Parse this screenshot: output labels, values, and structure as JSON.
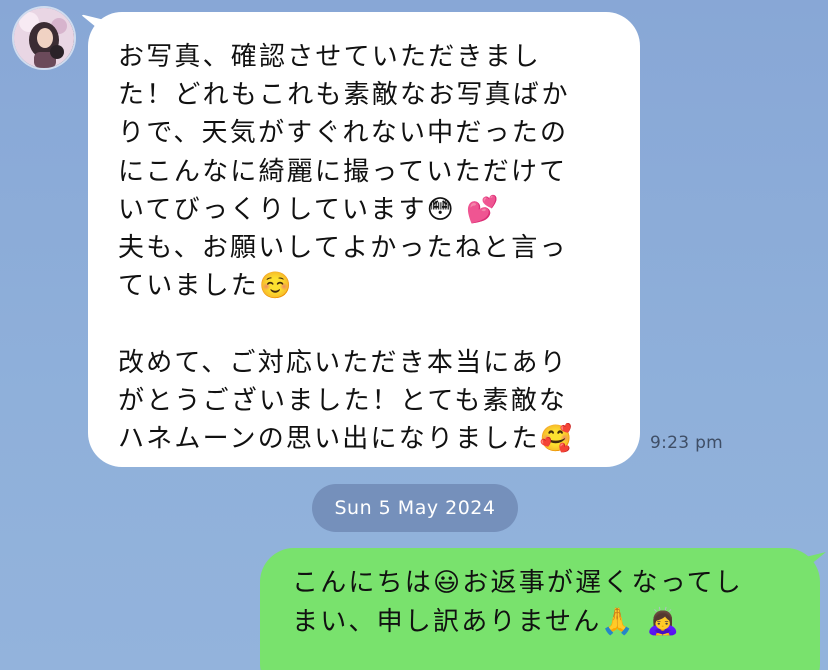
{
  "chat": {
    "background_color": "#8DABD8",
    "incoming": {
      "avatar_icon": "user-avatar",
      "text_lines": [
        "お写真、確認させていただきまし",
        "た！どれもこれも素敵なお写真ばか",
        "りで、天気がすぐれない中だったの",
        "にこんなに綺麗に撮っていただけて",
        "いてびっくりしています😳 💕",
        "夫も、お願いしてよかったねと言っ",
        "ていました☺️",
        "",
        "改めて、ご対応いただき本当にあり",
        "がとうございました！とても素敵な",
        "ハネムーンの思い出になりました🥰"
      ],
      "time": "9:23 pm",
      "bubble_color": "#FFFFFF"
    },
    "date_separator": "Sun 5 May 2024",
    "outgoing": {
      "text_lines": [
        "こんにちは😃お返事が遅くなってし",
        "まい、申し訳ありません🙏 🙇‍♀️"
      ],
      "bubble_color": "#79E26D"
    }
  }
}
